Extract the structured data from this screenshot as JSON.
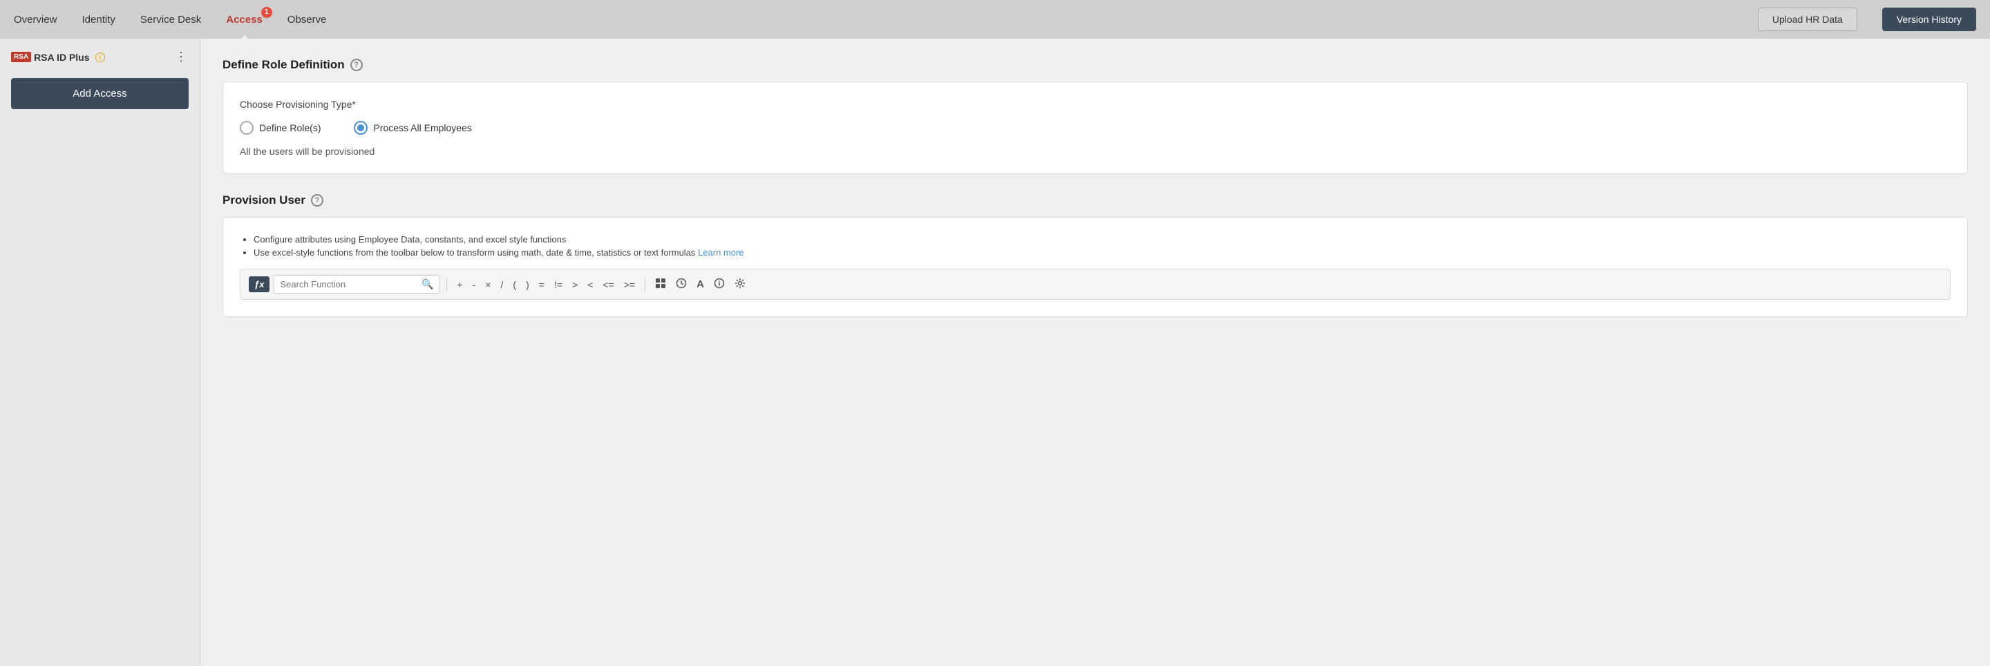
{
  "topnav": {
    "items": [
      {
        "id": "overview",
        "label": "Overview",
        "active": false
      },
      {
        "id": "identity",
        "label": "Identity",
        "active": false
      },
      {
        "id": "service-desk",
        "label": "Service Desk",
        "active": false
      },
      {
        "id": "access",
        "label": "Access",
        "active": true,
        "badge": "1"
      },
      {
        "id": "observe",
        "label": "Observe",
        "active": false
      }
    ],
    "upload_hr_btn": "Upload HR Data",
    "version_history_btn": "Version History"
  },
  "sidebar": {
    "logo_text": "RSA",
    "title": "RSA ID Plus",
    "add_access_btn": "Add Access"
  },
  "define_role": {
    "title": "Define Role Definition",
    "provisioning_label": "Choose Provisioning Type*",
    "option1": "Define Role(s)",
    "option2": "Process All Employees",
    "note": "All the users will be provisioned"
  },
  "provision_user": {
    "title": "Provision User",
    "bullet1": "Configure attributes using Employee Data, constants, and excel style functions",
    "bullet2": "Use excel-style functions from the toolbar below to transform using math, date & time, statistics or text formulas",
    "learn_more": "Learn more",
    "fx_badge": "ƒx",
    "search_placeholder": "Search Function",
    "toolbar_buttons": [
      "+",
      "-",
      "×",
      "/",
      "(",
      ")",
      "=",
      "!=",
      ">",
      "<",
      "<=",
      ">="
    ]
  }
}
